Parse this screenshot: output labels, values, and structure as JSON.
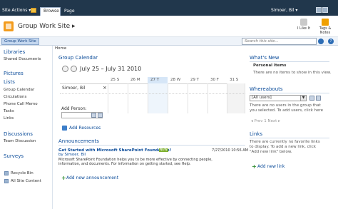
{
  "ribbon": {
    "site_actions": "Site Actions ▾",
    "tab_browse": "Browse",
    "tab_page": "Page",
    "user": "Simoer, Bil ▾"
  },
  "title_bar": {
    "site_title": "Group Work Site ▸",
    "like_label": "I Like It",
    "tags_label": "Tags & Notes"
  },
  "top_nav": {
    "current_tab": "Group Work Site",
    "search_placeholder": "Search this site..."
  },
  "breadcrumb": "Home",
  "left_nav": {
    "libraries_head": "Libraries",
    "libraries": [
      "Shared Documents"
    ],
    "pictures_head": "Pictures",
    "lists_head": "Lists",
    "lists": [
      "Group Calendar",
      "Circulations",
      "Phone Call Memo",
      "Tasks",
      "Links"
    ],
    "discussions_head": "Discussions",
    "discussions": [
      "Team Discussion"
    ],
    "surveys_head": "Surveys",
    "recycle_bin": "Recycle Bin",
    "all_site_content": "All Site Content"
  },
  "calendar": {
    "title": "Group Calendar",
    "range": "July 25 – July 31 2010",
    "days": [
      {
        "label": "25 S"
      },
      {
        "label": "26 M"
      },
      {
        "label": "27 T"
      },
      {
        "label": "28 W"
      },
      {
        "label": "29 T"
      },
      {
        "label": "30 F"
      },
      {
        "label": "31 S"
      }
    ],
    "today_index": 2,
    "person": "Simoer, Bil",
    "remove_label": "×",
    "add_person_label": "Add Person:",
    "add_resources_label": "Add Resources"
  },
  "announcements": {
    "title": "Announcements",
    "item_title": "Get Started with Microsoft SharePoint Foundation!",
    "new_badge": "NEW",
    "item_date": "7/27/2010 10:56 AM",
    "item_author": "by Simoer, Bil",
    "item_body": "Microsoft SharePoint Foundation helps you to be more effective by connecting people, information, and documents. For information on getting started, see Help.",
    "add_label": "Add new announcement"
  },
  "whats_new": {
    "title": "What's New",
    "personal_items": "Personal Items",
    "empty_text": "There are no items to show in this view."
  },
  "whereabouts": {
    "title": "Whereabouts",
    "select_value": "[All users]",
    "text": "There are no users in the group that you selected. To add users, click here",
    "pager": "◂ Prev  1  Next ▸"
  },
  "links": {
    "title": "Links",
    "text": "There are currently no favorite links to display. To add a new link, click \"Add new link\" below.",
    "add_label": "Add new link"
  },
  "colors": {
    "ribbon_bg": "#21374c",
    "link_blue": "#0a4b99",
    "accent_orange": "#f39c1d"
  }
}
